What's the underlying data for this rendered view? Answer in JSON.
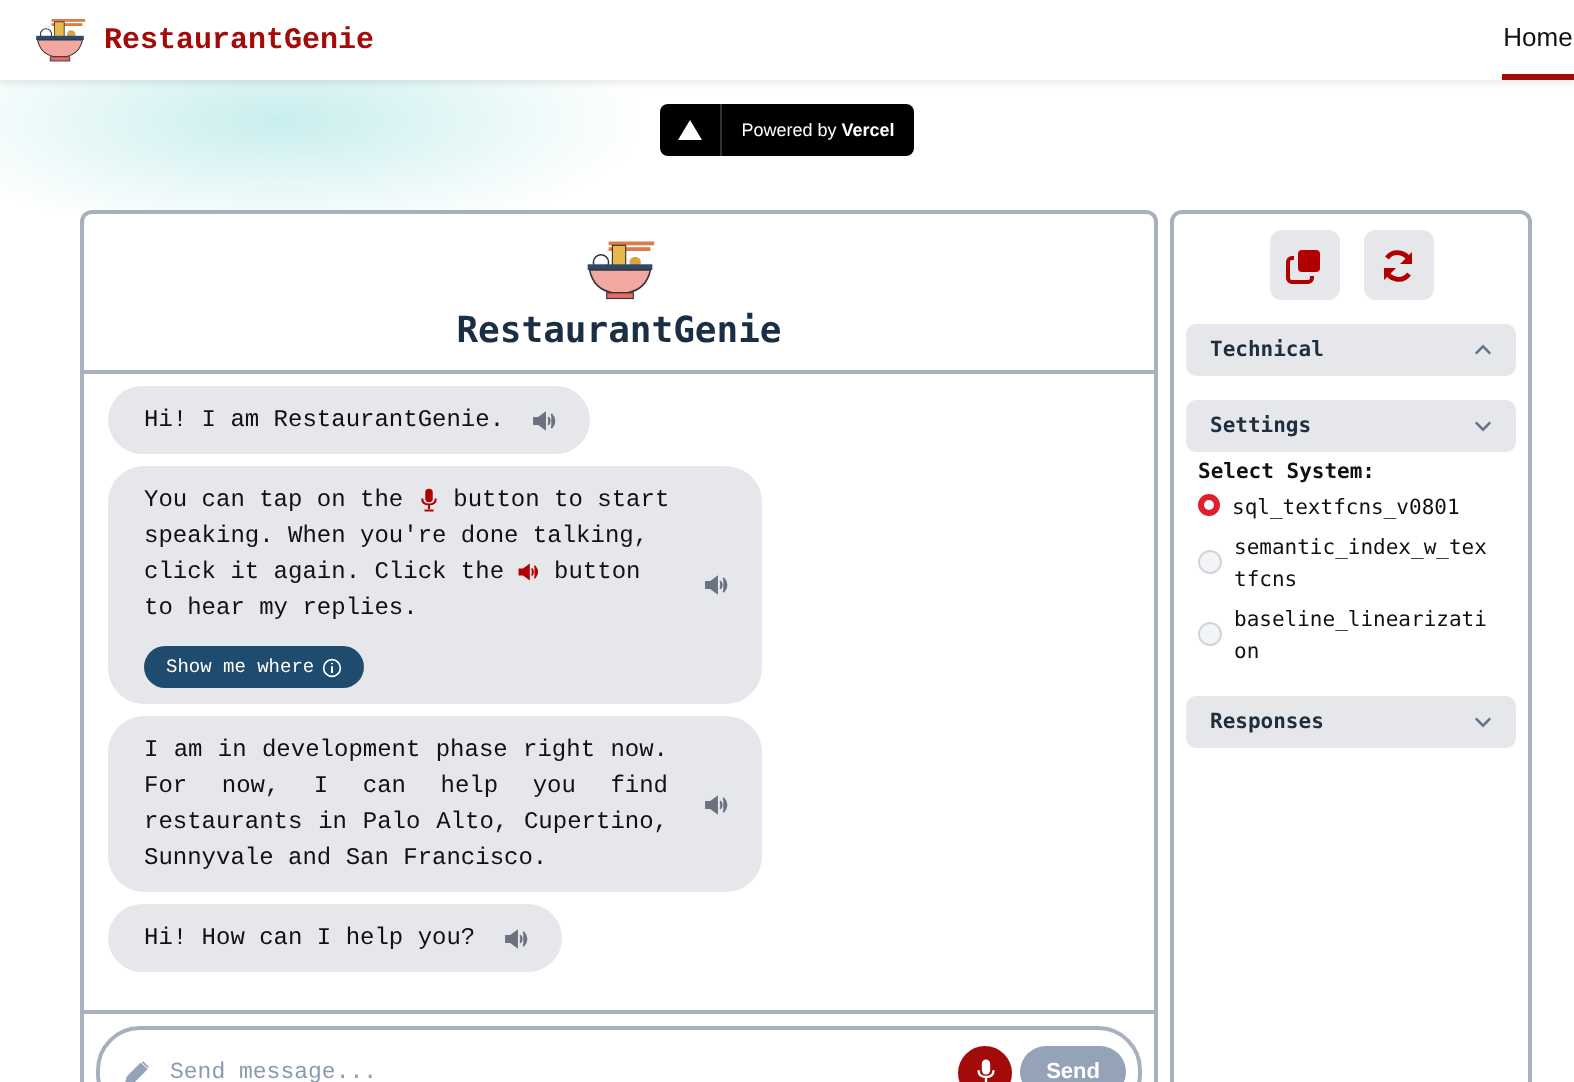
{
  "header": {
    "brand": "RestaurantGenie",
    "nav": [
      {
        "label": "Home",
        "selected": true
      }
    ]
  },
  "badge": {
    "label": "Powered by",
    "brand": "Vercel"
  },
  "chat": {
    "title": "RestaurantGenie",
    "messages": [
      {
        "lines": [
          [
            {
              "kind": "text",
              "text": "Hi! I am RestaurantGenie."
            }
          ]
        ]
      },
      {
        "lines": [
          [
            {
              "kind": "text",
              "text": "You can tap on the"
            },
            {
              "kind": "mic"
            },
            {
              "kind": "text",
              "text": "button to start"
            }
          ],
          [
            {
              "kind": "text",
              "text": "speaking. When you're done talking,"
            }
          ],
          [
            {
              "kind": "text",
              "text": "click it again. Click the"
            },
            {
              "kind": "speaker"
            },
            {
              "kind": "text",
              "text": "button"
            }
          ],
          [
            {
              "kind": "text",
              "text": "to hear my replies."
            }
          ]
        ],
        "action": "Show me where"
      },
      {
        "lines": [
          [
            {
              "kind": "text",
              "text": "I am in development phase right now."
            }
          ],
          [
            {
              "kind": "text",
              "text": "For now, I can help you find"
            }
          ],
          [
            {
              "kind": "text",
              "text": "restaurants in Palo Alto, Cupertino,"
            }
          ],
          [
            {
              "kind": "text",
              "text": "Sunnyvale and San Francisco."
            }
          ]
        ],
        "justify": true
      },
      {
        "lines": [
          [
            {
              "kind": "text",
              "text": "Hi! How can I help you?"
            }
          ]
        ]
      }
    ],
    "input": {
      "placeholder": "Send message..."
    },
    "send": "Send"
  },
  "sidebar": {
    "sections": [
      {
        "title": "Technical",
        "expanded": true
      },
      {
        "title": "Settings",
        "expanded": false,
        "label": "Select System:",
        "options": [
          {
            "label": "sql_textfcns_v0801",
            "selected": true
          },
          {
            "label": "semantic_index_w_textfcns",
            "selected": false
          },
          {
            "label": "baseline_linearization",
            "selected": false
          }
        ]
      },
      {
        "title": "Responses",
        "expanded": false
      }
    ]
  }
}
